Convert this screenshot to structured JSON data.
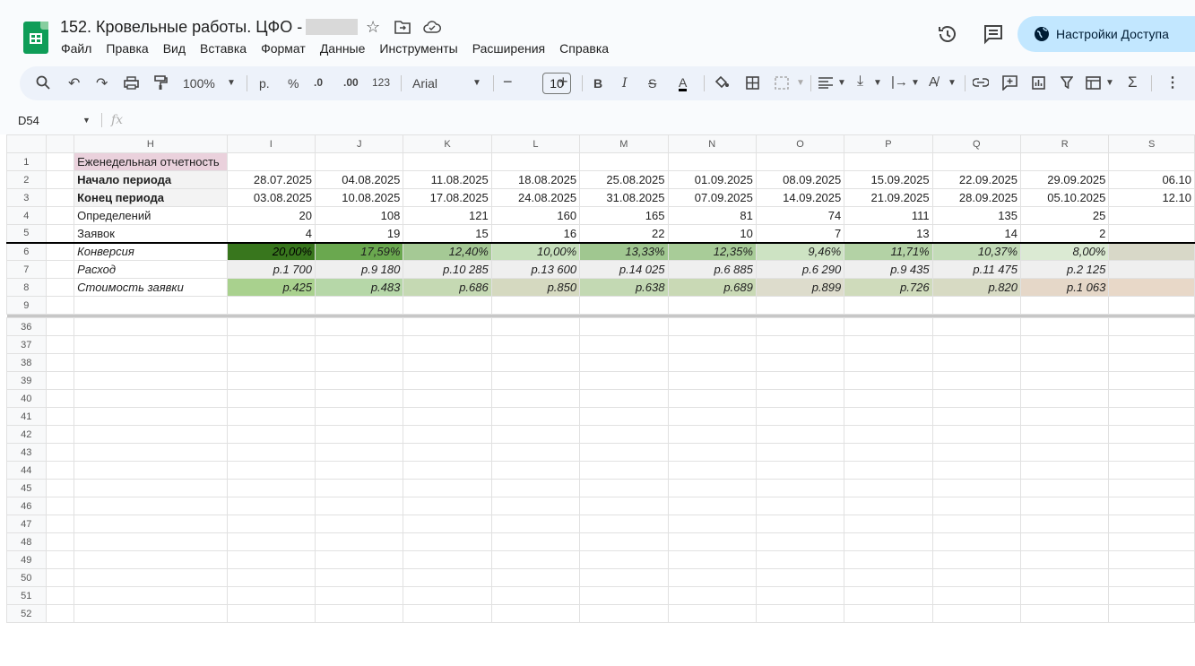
{
  "doc": {
    "title": "152. Кровельные работы. ЦФО -",
    "menu": [
      "Файл",
      "Правка",
      "Вид",
      "Вставка",
      "Формат",
      "Данные",
      "Инструменты",
      "Расширения",
      "Справка"
    ]
  },
  "share_label": "Настройки Доступа",
  "toolbar": {
    "zoom": "100%",
    "currency": "р.",
    "percent": "%",
    "dec_dec": ".0",
    "dec_inc": ".00",
    "number_fmt": "123",
    "font": "Arial",
    "font_size": "10"
  },
  "name_box": "D54",
  "fx": "fx",
  "columns": [
    "H",
    "I",
    "J",
    "K",
    "L",
    "M",
    "N",
    "O",
    "P",
    "Q",
    "R",
    "S"
  ],
  "rows": [
    {
      "n": "1",
      "label": "Еженедельная отчетность",
      "cells": [
        "",
        "",
        "",
        "",
        "",
        "",
        "",
        "",
        "",
        "",
        ""
      ]
    },
    {
      "n": "2",
      "label": "Начало периода",
      "cells": [
        "28.07.2025",
        "04.08.2025",
        "11.08.2025",
        "18.08.2025",
        "25.08.2025",
        "01.09.2025",
        "08.09.2025",
        "15.09.2025",
        "22.09.2025",
        "29.09.2025",
        "06.10"
      ]
    },
    {
      "n": "3",
      "label": "Конец периода",
      "cells": [
        "03.08.2025",
        "10.08.2025",
        "17.08.2025",
        "24.08.2025",
        "31.08.2025",
        "07.09.2025",
        "14.09.2025",
        "21.09.2025",
        "28.09.2025",
        "05.10.2025",
        "12.10"
      ]
    },
    {
      "n": "4",
      "label": "Определений",
      "cells": [
        "20",
        "108",
        "121",
        "160",
        "165",
        "81",
        "74",
        "111",
        "135",
        "25",
        ""
      ]
    },
    {
      "n": "5",
      "label": "Заявок",
      "cells": [
        "4",
        "19",
        "15",
        "16",
        "22",
        "10",
        "7",
        "13",
        "14",
        "2",
        ""
      ]
    },
    {
      "n": "6",
      "label": "Конверсия",
      "cells": [
        "20,00%",
        "17,59%",
        "12,40%",
        "10,00%",
        "13,33%",
        "12,35%",
        "9,46%",
        "11,71%",
        "10,37%",
        "8,00%",
        ""
      ]
    },
    {
      "n": "7",
      "label": "Расход",
      "cells": [
        "р.1 700",
        "р.9 180",
        "р.10 285",
        "р.13 600",
        "р.14 025",
        "р.6 885",
        "р.6 290",
        "р.9 435",
        "р.11 475",
        "р.2 125",
        ""
      ]
    },
    {
      "n": "8",
      "label": "Стоимость заявки",
      "cells": [
        "р.425",
        "р.483",
        "р.686",
        "р.850",
        "р.638",
        "р.689",
        "р.899",
        "р.726",
        "р.820",
        "р.1 063",
        ""
      ]
    },
    {
      "n": "9",
      "label": "",
      "cells": [
        "",
        "",
        "",
        "",
        "",
        "",
        "",
        "",
        "",
        "",
        ""
      ]
    }
  ],
  "lower_rows": [
    "36",
    "37",
    "38",
    "39",
    "40",
    "41",
    "42",
    "43",
    "44",
    "45",
    "46",
    "47",
    "48",
    "49",
    "50",
    "51",
    "52"
  ],
  "colors": {
    "conv": [
      "#38761d",
      "#6aa84f",
      "#a5c995",
      "#c7e0bc",
      "#a0c790",
      "#a8cc98",
      "#cde3c3",
      "#b3d2a5",
      "#c3dcb8",
      "#dbead3",
      "#d8d8c8"
    ],
    "spend": [
      "#efefef",
      "#efefef",
      "#efefef",
      "#efefef",
      "#efefef",
      "#efefef",
      "#efefef",
      "#efefef",
      "#efefef",
      "#efefef",
      "#efefef"
    ],
    "cpl": [
      "#a9d18e",
      "#b6d7a8",
      "#c5d9b3",
      "#d5d9c0",
      "#c3d9b3",
      "#c9d9b5",
      "#dddccc",
      "#cfdbbb",
      "#d7dac3",
      "#e5d7c8",
      "#e8d8c8"
    ]
  }
}
